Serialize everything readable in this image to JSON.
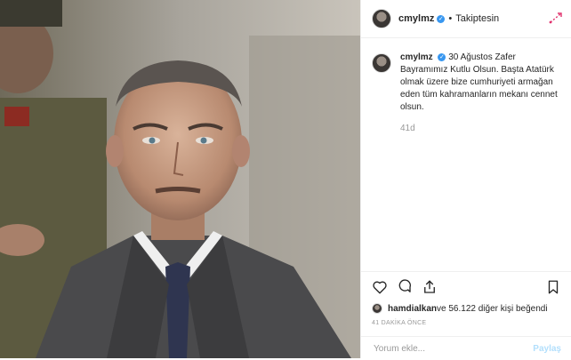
{
  "header": {
    "username": "cmylmz",
    "separator": "•",
    "follow_label": "Takiptesin"
  },
  "caption": {
    "username": "cmylmz",
    "text": "30 Ağustos Zafer Bayramımız Kutlu Olsun. Başta Atatürk olmak üzere bize cumhuriyeti armağan eden tüm kahramanların mekanı cennet olsun.",
    "time": "41d"
  },
  "likes": {
    "user": "hamdialkan",
    "rest": " ve 56.122 diğer kişi beğendi"
  },
  "timestamp": "41 DAKİKA ÖNCE",
  "comment": {
    "placeholder": "Yorum ekle...",
    "post_label": "Paylaş"
  },
  "icons": {
    "more": "more-icon",
    "like": "heart-icon",
    "comment": "comment-icon",
    "share": "share-icon",
    "save": "bookmark-icon",
    "verified": "verified-badge-icon"
  },
  "colors": {
    "verified": "#3897f0",
    "muted": "#999999",
    "post_button": "#b2dffc"
  }
}
